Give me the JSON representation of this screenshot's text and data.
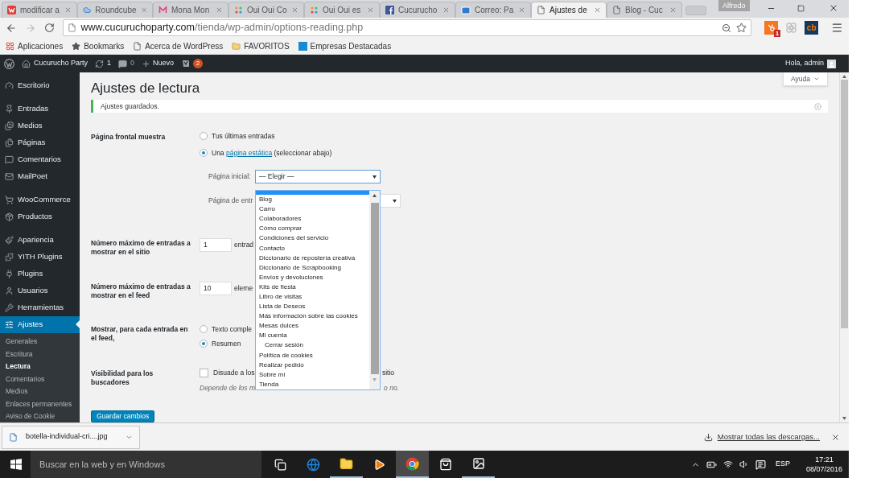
{
  "browser": {
    "tabs": [
      {
        "title": "modificar a",
        "kind": "w",
        "selected": false
      },
      {
        "title": "Roundcube",
        "kind": "cloud",
        "selected": false
      },
      {
        "title": "Mona Mon",
        "kind": "m",
        "selected": false
      },
      {
        "title": "Oui Oui Co",
        "kind": "dots",
        "selected": false
      },
      {
        "title": "Oui Oui es",
        "kind": "dots",
        "selected": false
      },
      {
        "title": "Cucurucho",
        "kind": "facebook",
        "selected": false
      },
      {
        "title": "Correo: Pa",
        "kind": "mail",
        "selected": false
      },
      {
        "title": "Ajustes de",
        "kind": "page",
        "selected": true
      },
      {
        "title": "Blog - Cuc",
        "kind": "page",
        "selected": false
      }
    ],
    "profile": "Alfredo",
    "url_domain": "www.cucuruchoparty.com",
    "url_path": "/tienda/wp-admin/options-reading.php",
    "extensions": [
      {
        "kind": "hubspot",
        "badge": "1"
      },
      {
        "kind": "flower"
      },
      {
        "kind": "logo",
        "text": "cb"
      }
    ],
    "bookmarks": [
      {
        "label": "Aplicaciones",
        "kind": "apps"
      },
      {
        "label": "Bookmarks",
        "kind": "star"
      },
      {
        "label": "Acerca de WordPress",
        "kind": "page"
      },
      {
        "label": "FAVORITOS",
        "kind": "folder"
      },
      {
        "label": "Empresas Destacadas",
        "kind": "tile"
      }
    ]
  },
  "admin_bar": {
    "site": "Cucurucho Party",
    "updates": "1",
    "comments": "0",
    "new": "Nuevo",
    "seo_badge": "2",
    "greeting": "Hola, admin"
  },
  "help": "Ayuda",
  "sidebar": {
    "groups": [
      [
        {
          "label": "Escritorio",
          "kind": "dashboard",
          "selected": false
        }
      ],
      [
        {
          "label": "Entradas",
          "kind": "pin",
          "selected": false
        },
        {
          "label": "Medios",
          "kind": "media",
          "selected": false
        },
        {
          "label": "Páginas",
          "kind": "pages",
          "selected": false
        },
        {
          "label": "Comentarios",
          "kind": "comments",
          "selected": false
        },
        {
          "label": "MailPoet",
          "kind": "mail",
          "selected": false
        }
      ],
      [
        {
          "label": "WooCommerce",
          "kind": "woo",
          "selected": false
        },
        {
          "label": "Productos",
          "kind": "box",
          "selected": false
        }
      ],
      [
        {
          "label": "Apariencia",
          "kind": "brush",
          "selected": false
        },
        {
          "label": "YITH Plugins",
          "kind": "yith",
          "selected": false
        },
        {
          "label": "Plugins",
          "kind": "plug",
          "selected": false
        },
        {
          "label": "Usuarios",
          "kind": "user",
          "selected": false
        },
        {
          "label": "Herramientas",
          "kind": "tools",
          "selected": false
        },
        {
          "label": "Ajustes",
          "kind": "settings",
          "selected": true
        }
      ]
    ],
    "submenu": [
      {
        "label": "Generales",
        "selected": false
      },
      {
        "label": "Escritura",
        "selected": false
      },
      {
        "label": "Lectura",
        "selected": true
      },
      {
        "label": "Comentarios",
        "selected": false
      },
      {
        "label": "Medios",
        "selected": false
      },
      {
        "label": "Enlaces permanentes",
        "selected": false
      },
      {
        "label": "Aviso de Cookie",
        "selected": false
      }
    ]
  },
  "page": {
    "title": "Ajustes de lectura",
    "notice": "Ajustes guardados.",
    "front_page": {
      "label": "Página frontal muestra",
      "options": [
        {
          "text": "Tus últimas entradas",
          "selected": false
        },
        {
          "before": "Una",
          "link": "página estática",
          "after": "(seleccionar abajo)",
          "selected": true
        }
      ],
      "home_label": "Página inicial:",
      "home_value": "— Elegir —",
      "posts_label": "Página de entr"
    },
    "posts_per_page": {
      "label": "Número máximo de entradas a mostrar en el sitio",
      "value": "1",
      "suffix": "entrad"
    },
    "feed_count": {
      "label": "Número máximo de entradas a mostrar en el feed",
      "value": "10",
      "suffix": "eleme"
    },
    "feed_content": {
      "label": "Mostrar, para cada entrada en el feed,",
      "options": [
        {
          "text": "Texto comple",
          "selected": false
        },
        {
          "text": "Resumen",
          "selected": true
        }
      ]
    },
    "visibility": {
      "label": "Visibilidad para los buscadores",
      "checked": false,
      "text": "Disuade a los",
      "text_end": "sitio",
      "hint": "Depende de los m",
      "hint_end": "o no."
    },
    "save": "Guardar cambios"
  },
  "dropdown": {
    "options": [
      {
        "label": "Blog"
      },
      {
        "label": "Carro"
      },
      {
        "label": "Colaboradores"
      },
      {
        "label": "Cómo comprar"
      },
      {
        "label": "Condiciones del servicio"
      },
      {
        "label": "Contacto"
      },
      {
        "label": "Diccionario de repostería creativa"
      },
      {
        "label": "Diccionario de Scrapbooking"
      },
      {
        "label": "Envíos y devoluciones"
      },
      {
        "label": "Kits de fiesta"
      },
      {
        "label": "Libro de visitas"
      },
      {
        "label": "Lista de Deseos"
      },
      {
        "label": "Más información sobre las cookies"
      },
      {
        "label": "Mesas dulces"
      },
      {
        "label": "Mi cuenta",
        "children": [
          {
            "label": "Cerrar sesión"
          }
        ]
      },
      {
        "label": "Política de cookies"
      },
      {
        "label": "Realizar pedido"
      },
      {
        "label": "Sobre mí"
      },
      {
        "label": "Tienda"
      }
    ]
  },
  "downloads": {
    "file": "botella-individual-cri....jpg",
    "show_all": "Mostrar todas las descargas..."
  },
  "taskbar": {
    "search": "Buscar en la web y en Windows",
    "apps": [
      {
        "kind": "taskview",
        "running": false,
        "selected": false
      },
      {
        "kind": "edge",
        "running": false,
        "selected": false
      },
      {
        "kind": "explorer",
        "running": true,
        "selected": false
      },
      {
        "kind": "media",
        "running": false,
        "selected": false
      },
      {
        "kind": "chrome",
        "running": true,
        "selected": true
      },
      {
        "kind": "store",
        "running": false,
        "selected": false
      },
      {
        "kind": "photos",
        "running": true,
        "selected": false
      }
    ],
    "language": "ESP",
    "time": "17:21",
    "date": "08/07/2016"
  }
}
